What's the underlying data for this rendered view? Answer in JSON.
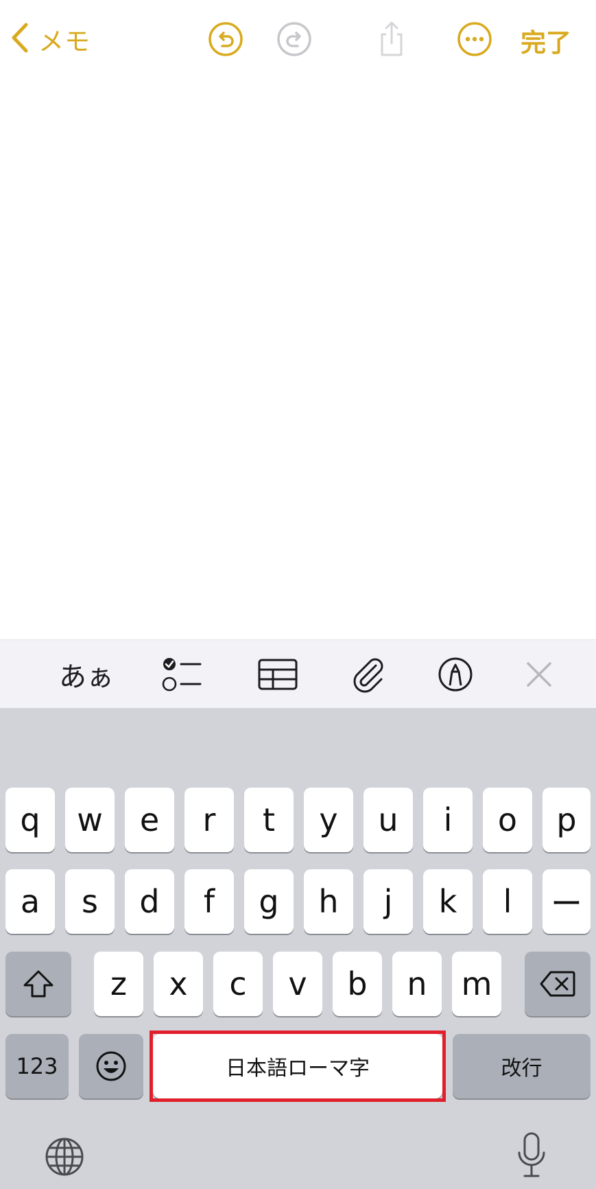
{
  "nav": {
    "back_label": "メモ",
    "done_label": "完了",
    "accent_color": "#d9aa1f",
    "icons": [
      "chevron-left-icon",
      "undo-icon",
      "redo-icon",
      "share-icon",
      "more-icon"
    ]
  },
  "format_bar": {
    "text_style_label": "あぁ",
    "icons": [
      "checklist-icon",
      "table-icon",
      "paperclip-icon",
      "markup-pen-icon",
      "close-icon"
    ]
  },
  "keyboard": {
    "row1": [
      "q",
      "w",
      "e",
      "r",
      "t",
      "y",
      "u",
      "i",
      "o",
      "p"
    ],
    "row2": [
      "a",
      "s",
      "d",
      "f",
      "g",
      "h",
      "j",
      "k",
      "l",
      "ー"
    ],
    "row3": [
      "z",
      "x",
      "c",
      "v",
      "b",
      "n",
      "m"
    ],
    "numbers_label": "123",
    "space_label": "日本語ローマ字",
    "return_label": "改行",
    "highlight_color": "#e11f2b"
  }
}
